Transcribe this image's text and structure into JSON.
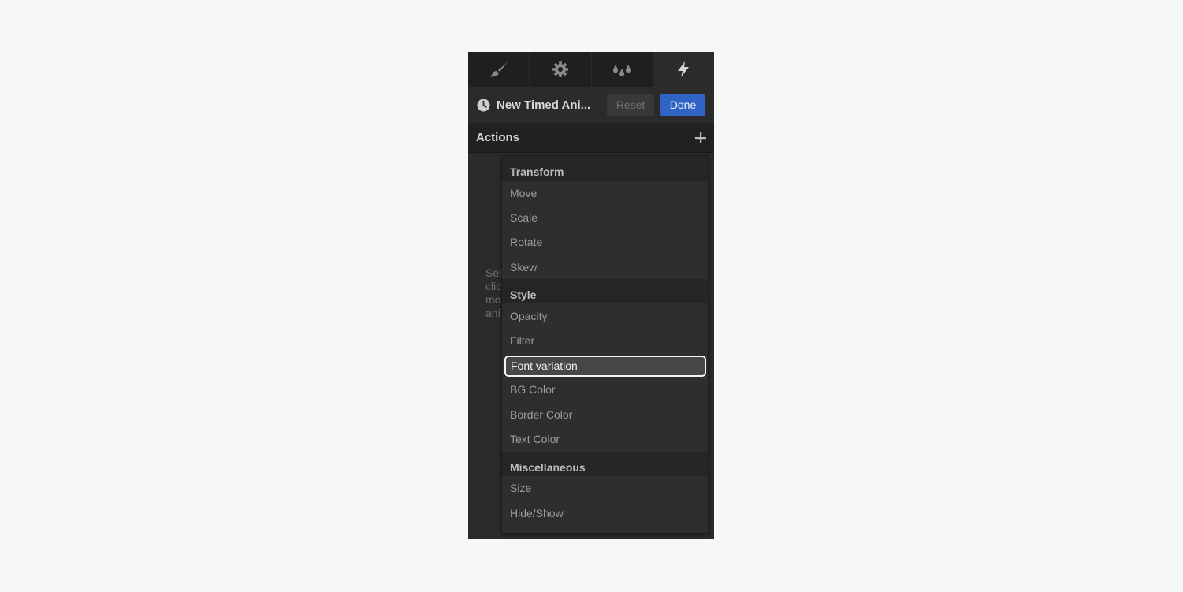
{
  "tabs": [
    {
      "icon": "brush-icon",
      "active": false
    },
    {
      "icon": "gear-icon",
      "active": false
    },
    {
      "icon": "drops-icon",
      "active": false
    },
    {
      "icon": "lightning-icon",
      "active": true
    }
  ],
  "header": {
    "icon": "clock-icon",
    "title": "New Timed Ani...",
    "reset_label": "Reset",
    "done_label": "Done"
  },
  "actions": {
    "label": "Actions",
    "add_icon": "plus-icon"
  },
  "hint_lines": [
    "Sel",
    "clic",
    "mo",
    "ani"
  ],
  "dropdown": {
    "groups": [
      {
        "title": "Transform",
        "items": [
          "Move",
          "Scale",
          "Rotate",
          "Skew"
        ]
      },
      {
        "title": "Style",
        "items": [
          "Opacity",
          "Filter",
          "Font variation",
          "BG Color",
          "Border Color",
          "Text Color"
        ]
      },
      {
        "title": "Miscellaneous",
        "items": [
          "Size",
          "Hide/Show"
        ]
      }
    ],
    "highlighted_item": "Font variation"
  },
  "colors": {
    "panel_bg": "#2b2b2b",
    "tab_bar_bg": "#1f1f1f",
    "done_button": "#2f63c4",
    "highlight_border": "#f3f3f3"
  }
}
